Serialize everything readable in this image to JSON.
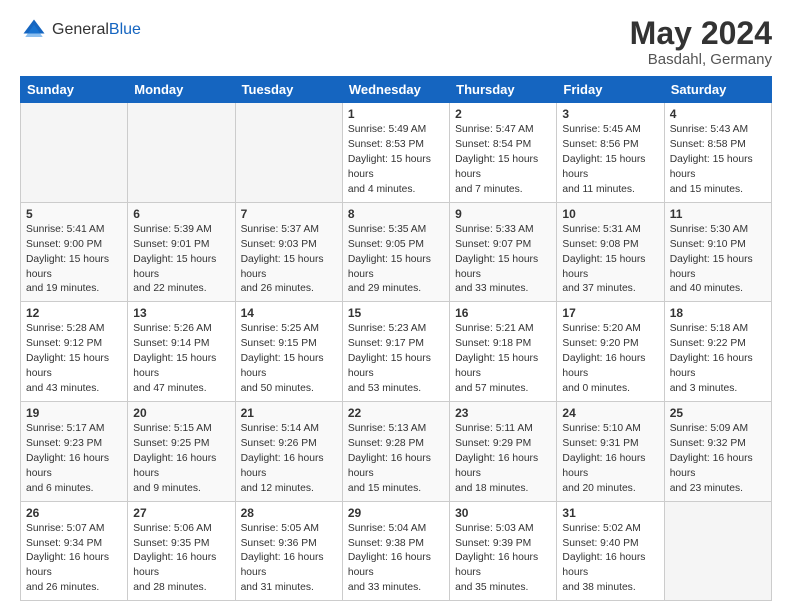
{
  "header": {
    "logo_general": "General",
    "logo_blue": "Blue",
    "month_title": "May 2024",
    "location": "Basdahl, Germany"
  },
  "weekdays": [
    "Sunday",
    "Monday",
    "Tuesday",
    "Wednesday",
    "Thursday",
    "Friday",
    "Saturday"
  ],
  "weeks": [
    [
      {
        "day": "",
        "empty": true
      },
      {
        "day": "",
        "empty": true
      },
      {
        "day": "",
        "empty": true
      },
      {
        "day": "1",
        "sunrise": "5:49 AM",
        "sunset": "8:53 PM",
        "daylight": "15 hours and 4 minutes."
      },
      {
        "day": "2",
        "sunrise": "5:47 AM",
        "sunset": "8:54 PM",
        "daylight": "15 hours and 7 minutes."
      },
      {
        "day": "3",
        "sunrise": "5:45 AM",
        "sunset": "8:56 PM",
        "daylight": "15 hours and 11 minutes."
      },
      {
        "day": "4",
        "sunrise": "5:43 AM",
        "sunset": "8:58 PM",
        "daylight": "15 hours and 15 minutes."
      }
    ],
    [
      {
        "day": "5",
        "sunrise": "5:41 AM",
        "sunset": "9:00 PM",
        "daylight": "15 hours and 19 minutes."
      },
      {
        "day": "6",
        "sunrise": "5:39 AM",
        "sunset": "9:01 PM",
        "daylight": "15 hours and 22 minutes."
      },
      {
        "day": "7",
        "sunrise": "5:37 AM",
        "sunset": "9:03 PM",
        "daylight": "15 hours and 26 minutes."
      },
      {
        "day": "8",
        "sunrise": "5:35 AM",
        "sunset": "9:05 PM",
        "daylight": "15 hours and 29 minutes."
      },
      {
        "day": "9",
        "sunrise": "5:33 AM",
        "sunset": "9:07 PM",
        "daylight": "15 hours and 33 minutes."
      },
      {
        "day": "10",
        "sunrise": "5:31 AM",
        "sunset": "9:08 PM",
        "daylight": "15 hours and 37 minutes."
      },
      {
        "day": "11",
        "sunrise": "5:30 AM",
        "sunset": "9:10 PM",
        "daylight": "15 hours and 40 minutes."
      }
    ],
    [
      {
        "day": "12",
        "sunrise": "5:28 AM",
        "sunset": "9:12 PM",
        "daylight": "15 hours and 43 minutes."
      },
      {
        "day": "13",
        "sunrise": "5:26 AM",
        "sunset": "9:14 PM",
        "daylight": "15 hours and 47 minutes."
      },
      {
        "day": "14",
        "sunrise": "5:25 AM",
        "sunset": "9:15 PM",
        "daylight": "15 hours and 50 minutes."
      },
      {
        "day": "15",
        "sunrise": "5:23 AM",
        "sunset": "9:17 PM",
        "daylight": "15 hours and 53 minutes."
      },
      {
        "day": "16",
        "sunrise": "5:21 AM",
        "sunset": "9:18 PM",
        "daylight": "15 hours and 57 minutes."
      },
      {
        "day": "17",
        "sunrise": "5:20 AM",
        "sunset": "9:20 PM",
        "daylight": "16 hours and 0 minutes."
      },
      {
        "day": "18",
        "sunrise": "5:18 AM",
        "sunset": "9:22 PM",
        "daylight": "16 hours and 3 minutes."
      }
    ],
    [
      {
        "day": "19",
        "sunrise": "5:17 AM",
        "sunset": "9:23 PM",
        "daylight": "16 hours and 6 minutes."
      },
      {
        "day": "20",
        "sunrise": "5:15 AM",
        "sunset": "9:25 PM",
        "daylight": "16 hours and 9 minutes."
      },
      {
        "day": "21",
        "sunrise": "5:14 AM",
        "sunset": "9:26 PM",
        "daylight": "16 hours and 12 minutes."
      },
      {
        "day": "22",
        "sunrise": "5:13 AM",
        "sunset": "9:28 PM",
        "daylight": "16 hours and 15 minutes."
      },
      {
        "day": "23",
        "sunrise": "5:11 AM",
        "sunset": "9:29 PM",
        "daylight": "16 hours and 18 minutes."
      },
      {
        "day": "24",
        "sunrise": "5:10 AM",
        "sunset": "9:31 PM",
        "daylight": "16 hours and 20 minutes."
      },
      {
        "day": "25",
        "sunrise": "5:09 AM",
        "sunset": "9:32 PM",
        "daylight": "16 hours and 23 minutes."
      }
    ],
    [
      {
        "day": "26",
        "sunrise": "5:07 AM",
        "sunset": "9:34 PM",
        "daylight": "16 hours and 26 minutes."
      },
      {
        "day": "27",
        "sunrise": "5:06 AM",
        "sunset": "9:35 PM",
        "daylight": "16 hours and 28 minutes."
      },
      {
        "day": "28",
        "sunrise": "5:05 AM",
        "sunset": "9:36 PM",
        "daylight": "16 hours and 31 minutes."
      },
      {
        "day": "29",
        "sunrise": "5:04 AM",
        "sunset": "9:38 PM",
        "daylight": "16 hours and 33 minutes."
      },
      {
        "day": "30",
        "sunrise": "5:03 AM",
        "sunset": "9:39 PM",
        "daylight": "16 hours and 35 minutes."
      },
      {
        "day": "31",
        "sunrise": "5:02 AM",
        "sunset": "9:40 PM",
        "daylight": "16 hours and 38 minutes."
      },
      {
        "day": "",
        "empty": true
      }
    ]
  ],
  "labels": {
    "sunrise": "Sunrise:",
    "sunset": "Sunset:",
    "daylight": "Daylight hours"
  }
}
